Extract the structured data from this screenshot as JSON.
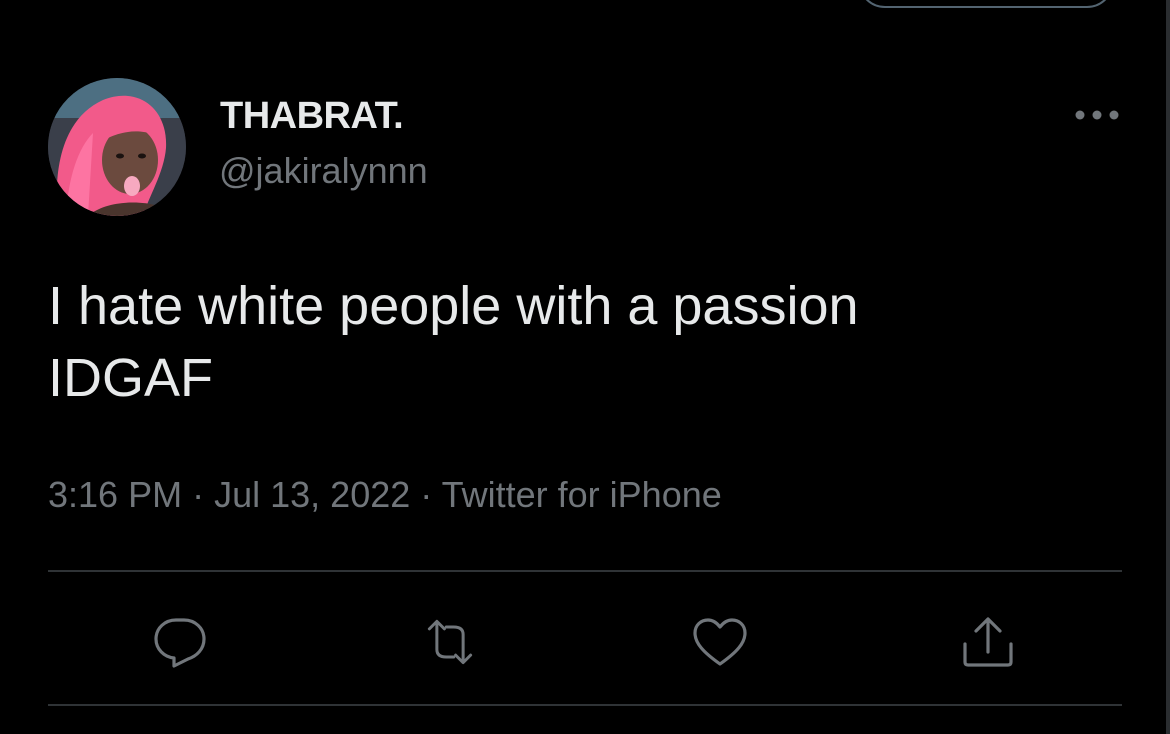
{
  "tweet": {
    "display_name": "THABRAT.",
    "handle": "@jakiralynnn",
    "text": "I hate white people with a passion\nIDGAF",
    "time": "3:16 PM",
    "date": "Jul 13, 2022",
    "source": "Twitter for iPhone",
    "separator": "·"
  },
  "icons": {
    "more": "more-horizontal-icon",
    "reply": "reply-bubble-icon",
    "retweet": "retweet-icon",
    "like": "heart-icon",
    "share": "share-icon"
  },
  "colors": {
    "background": "#000000",
    "primary_text": "#e7e9ea",
    "secondary_text": "#71767b",
    "divider": "#2f3336",
    "avatar_hair": "#f25a8a"
  }
}
